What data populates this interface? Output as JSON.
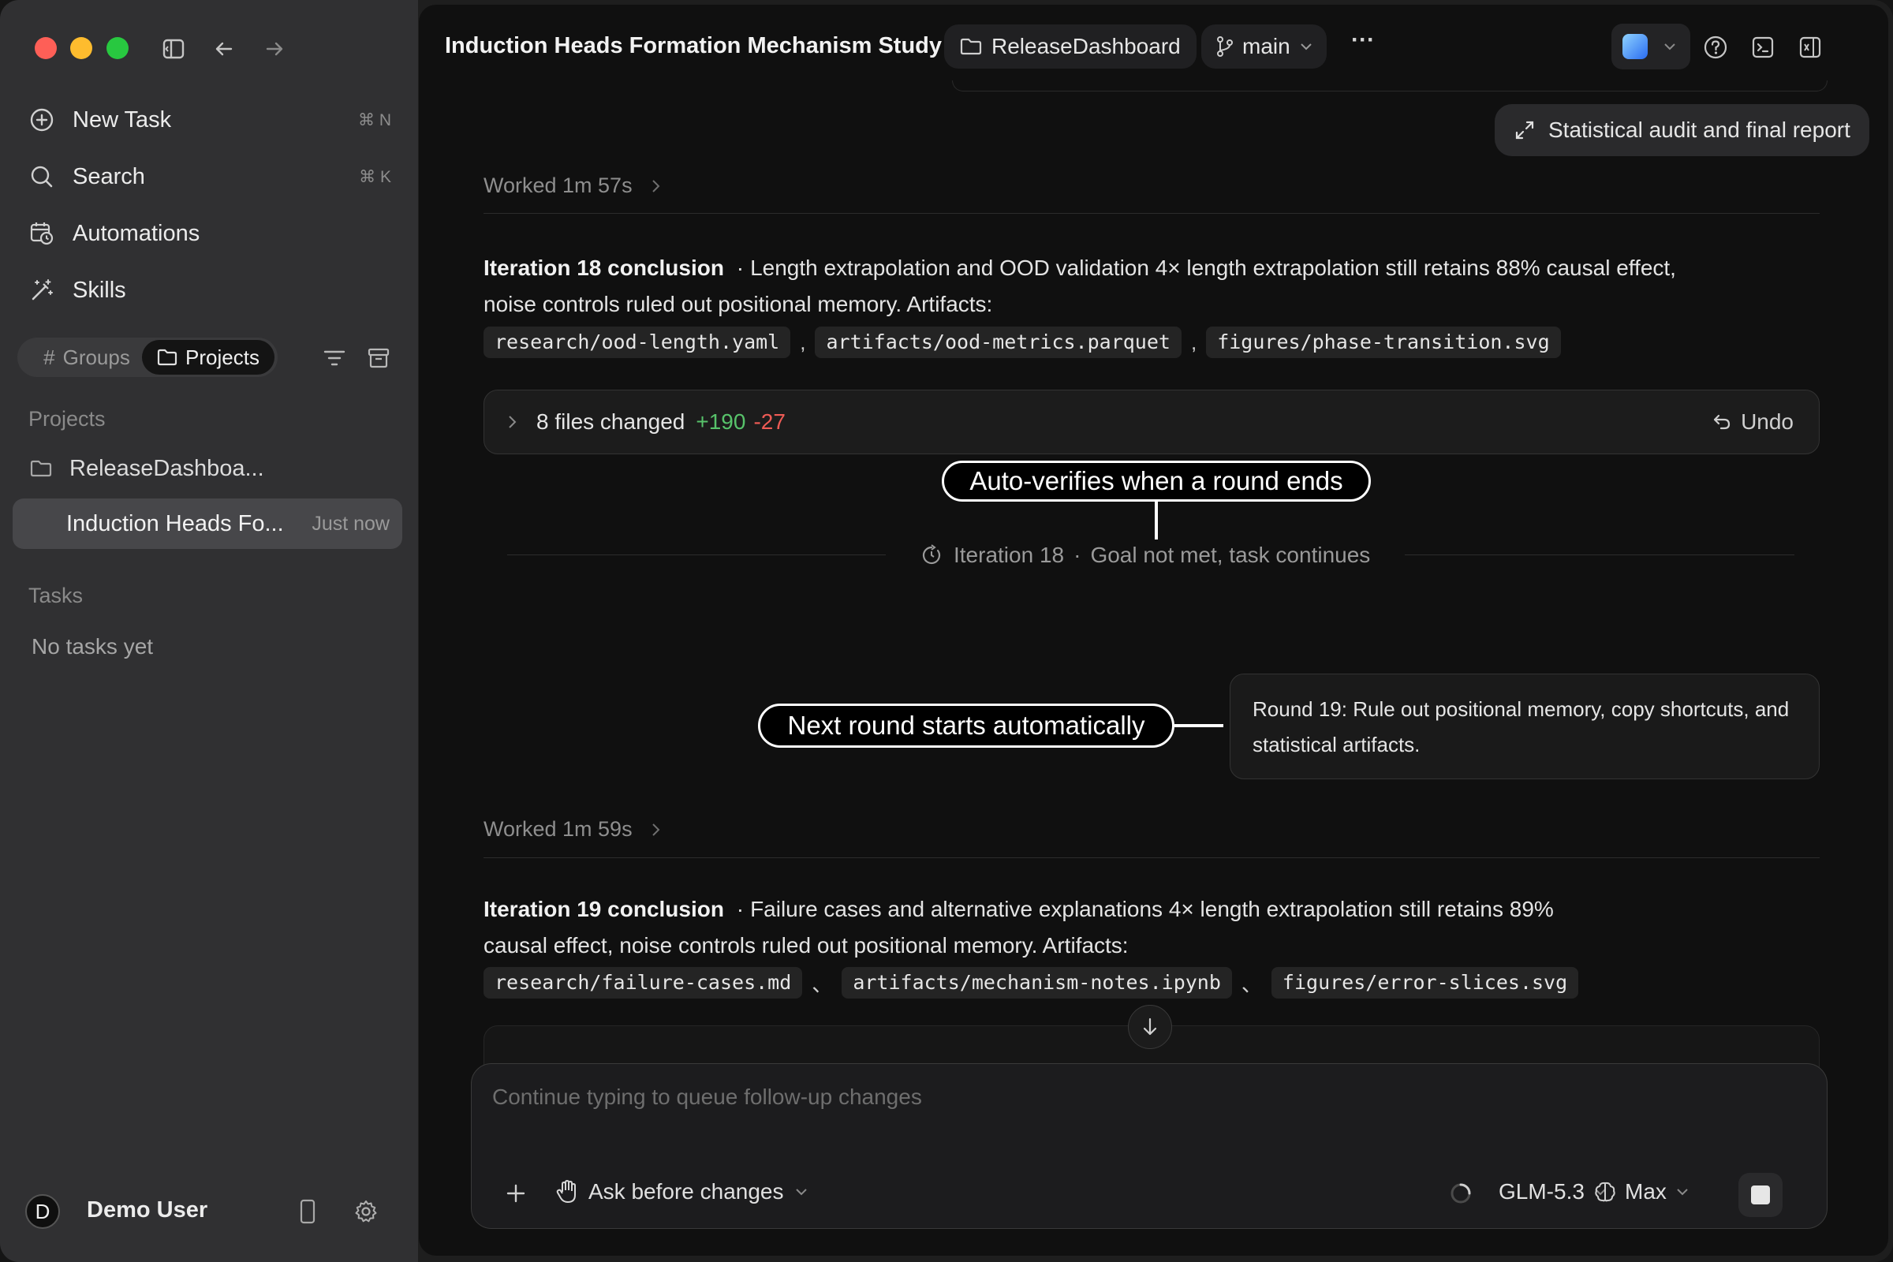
{
  "app": {
    "project_title": "Induction Heads Formation Mechanism Study",
    "folder_chip": "ReleaseDashboard",
    "branch_chip": "main",
    "more": "···"
  },
  "sidebar": {
    "nav": [
      {
        "label": "New Task",
        "shortcut": "⌘ N",
        "icon": "plus-circle-icon"
      },
      {
        "label": "Search",
        "shortcut": "⌘ K",
        "icon": "search-icon"
      },
      {
        "label": "Automations",
        "shortcut": "",
        "icon": "calendar-clock-icon"
      },
      {
        "label": "Skills",
        "shortcut": "",
        "icon": "magic-wand-icon"
      }
    ],
    "segment": {
      "groups": "Groups",
      "groups_prefix": "#",
      "projects": "Projects"
    },
    "projects_header": "Projects",
    "project_items": [
      {
        "label": "ReleaseDashboa...",
        "time": ""
      },
      {
        "label": "Induction Heads Fo...",
        "time": "Just now"
      }
    ],
    "tasks_header": "Tasks",
    "tasks_empty": "No tasks yet",
    "user": {
      "initial": "D",
      "name": "Demo User"
    }
  },
  "thread": {
    "audit_chip": "Statistical audit and final report",
    "worked_1": "Worked 1m 57s",
    "iter18": {
      "title": "Iteration 18 conclusion",
      "sep": "·",
      "text": "Length extrapolation and OOD validation 4× length extrapolation still retains 88% causal effect, noise controls ruled out positional memory. Artifacts:",
      "artifacts": [
        "research/ood-length.yaml",
        "artifacts/ood-metrics.parquet",
        "figures/phase-transition.svg"
      ],
      "artifact_sep": ","
    },
    "files_changed": {
      "label": "8 files changed",
      "added": "+190",
      "removed": "-27",
      "undo": "Undo"
    },
    "callout_1": "Auto-verifies when a round ends",
    "status_line": {
      "iteration": "Iteration 18",
      "sep": "·",
      "status": "Goal not met, task continues"
    },
    "callout_2": "Next round starts automatically",
    "round_msg": "Round 19: Rule out positional memory, copy shortcuts, and statistical artifacts.",
    "worked_2": "Worked 1m 59s",
    "iter19": {
      "title": "Iteration 19 conclusion",
      "sep": "·",
      "text": "Failure cases and alternative explanations 4× length extrapolation still retains 89% causal effect, noise controls ruled out positional memory. Artifacts:",
      "artifacts": [
        "research/failure-cases.md",
        "artifacts/mechanism-notes.ipynb",
        "figures/error-slices.svg"
      ],
      "artifact_sep": "、"
    }
  },
  "composer": {
    "placeholder": "Continue typing to queue follow-up changes",
    "mode": "Ask before changes",
    "model": "GLM-5.3",
    "effort": "Max"
  },
  "colors": {
    "accent_green": "#57c26a",
    "accent_red": "#ee5b55",
    "traffic_red": "#fe5f57",
    "traffic_yellow": "#febc2e",
    "traffic_green": "#28c840"
  }
}
